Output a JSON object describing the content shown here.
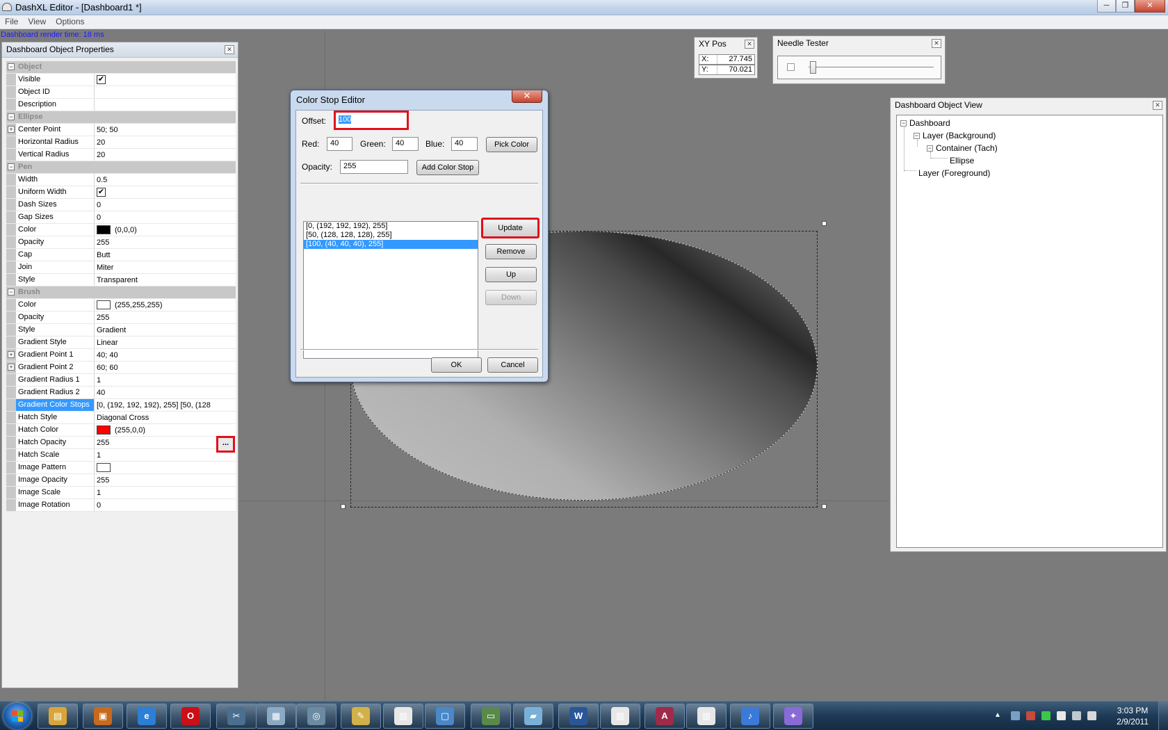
{
  "window": {
    "title": "DashXL Editor - [Dashboard1 *]",
    "controls": {
      "minimize": "─",
      "maximize": "❐",
      "close": "✕"
    }
  },
  "menu": [
    "File",
    "View",
    "Options"
  ],
  "status": {
    "render_time": "Dashboard render time: 18 ms"
  },
  "properties_panel": {
    "title": "Dashboard Object Properties",
    "rows": [
      {
        "type": "category",
        "name": "Object",
        "expander": "−"
      },
      {
        "name": "Visible",
        "value": "",
        "checkbox": true
      },
      {
        "name": "Object ID",
        "value": ""
      },
      {
        "name": "Description",
        "value": ""
      },
      {
        "type": "category",
        "name": "Ellipse",
        "expander": "−"
      },
      {
        "name": "Center Point",
        "value": "50; 50",
        "expander": "+"
      },
      {
        "name": "Horizontal Radius",
        "value": "20"
      },
      {
        "name": "Vertical Radius",
        "value": "20"
      },
      {
        "type": "category",
        "name": "Pen",
        "expander": "−"
      },
      {
        "name": "Width",
        "value": "0.5"
      },
      {
        "name": "Uniform Width",
        "value": "",
        "checkbox": true
      },
      {
        "name": "Dash Sizes",
        "value": "0"
      },
      {
        "name": "Gap Sizes",
        "value": "0"
      },
      {
        "name": "Color",
        "value": "(0,0,0)",
        "swatch": "#000000"
      },
      {
        "name": "Opacity",
        "value": "255"
      },
      {
        "name": "Cap",
        "value": "Butt"
      },
      {
        "name": "Join",
        "value": "Miter"
      },
      {
        "name": "Style",
        "value": "Transparent"
      },
      {
        "type": "category",
        "name": "Brush",
        "expander": "−"
      },
      {
        "name": "Color",
        "value": "(255,255,255)",
        "swatch": "#ffffff"
      },
      {
        "name": "Opacity",
        "value": "255"
      },
      {
        "name": "Style",
        "value": "Gradient"
      },
      {
        "name": "Gradient Style",
        "value": "Linear"
      },
      {
        "name": "Gradient Point 1",
        "value": "40; 40",
        "expander": "+"
      },
      {
        "name": "Gradient Point 2",
        "value": "60; 60",
        "expander": "+"
      },
      {
        "name": "Gradient Radius 1",
        "value": "1"
      },
      {
        "name": "Gradient Radius 2",
        "value": "40"
      },
      {
        "name": "Gradient Color Stops",
        "value": "[0, (192, 192, 192), 255]  [50, (128",
        "selected": true
      },
      {
        "name": "Hatch Style",
        "value": "Diagonal Cross"
      },
      {
        "name": "Hatch Color",
        "value": "(255,0,0)",
        "swatch": "#ff0000"
      },
      {
        "name": "Hatch Opacity",
        "value": "255"
      },
      {
        "name": "Hatch Scale",
        "value": "1"
      },
      {
        "name": "Image Pattern",
        "value": "",
        "swatch": "#ffffff"
      },
      {
        "name": "Image Opacity",
        "value": "255"
      },
      {
        "name": "Image Scale",
        "value": "1"
      },
      {
        "name": "Image Rotation",
        "value": "0"
      }
    ],
    "ellipsis_label": "..."
  },
  "xy_pos": {
    "title": "XY Pos",
    "x_label": "X:",
    "x_value": "27.745",
    "y_label": "Y:",
    "y_value": "70.021"
  },
  "needle_tester": {
    "title": "Needle Tester",
    "slider_value": 0
  },
  "object_view": {
    "title": "Dashboard Object View",
    "tree": [
      {
        "label": "Dashboard",
        "expander": "−"
      },
      {
        "label": "Layer (Background)",
        "expander": "−"
      },
      {
        "label": "Container (Tach)",
        "expander": "−"
      },
      {
        "label": "Ellipse"
      },
      {
        "label": "Layer (Foreground)"
      }
    ]
  },
  "color_stop_editor": {
    "title": "Color Stop Editor",
    "close": "✕",
    "offset_label": "Offset:",
    "offset_value": "100",
    "red_label": "Red:",
    "red_value": "40",
    "green_label": "Green:",
    "green_value": "40",
    "blue_label": "Blue:",
    "blue_value": "40",
    "pick_color": "Pick Color",
    "opacity_label": "Opacity:",
    "opacity_value": "255",
    "add_color_stop": "Add Color Stop",
    "stops": [
      "[0, (192, 192, 192), 255]",
      "[50, (128, 128, 128), 255]",
      "[100, (40, 40, 40), 255]"
    ],
    "selected_stop": 2,
    "update": "Update",
    "remove": "Remove",
    "up": "Up",
    "down": "Down",
    "ok": "OK",
    "cancel": "Cancel"
  },
  "taskbar": {
    "apps": [
      {
        "name": "explorer-icon",
        "glyph": "▤",
        "color": "#d9a53a"
      },
      {
        "name": "virtualpc-icon",
        "glyph": "▣",
        "color": "#c86a1e"
      },
      {
        "name": "ie-icon",
        "glyph": "e",
        "color": "#2b7fd6"
      },
      {
        "name": "opera-icon",
        "glyph": "O",
        "color": "#cc0f16"
      },
      {
        "name": "snipping-icon",
        "glyph": "✂",
        "color": "#4a6f8f"
      },
      {
        "name": "dashxl-icon",
        "glyph": "▦",
        "color": "#8aa9c4"
      },
      {
        "name": "network-icon",
        "glyph": "◎",
        "color": "#6b8aa3"
      },
      {
        "name": "paint-icon",
        "glyph": "✎",
        "color": "#d2b14a"
      },
      {
        "name": "document-icon",
        "glyph": "▥",
        "color": "#e7e7e7"
      },
      {
        "name": "remote-desktop-icon",
        "glyph": "▢",
        "color": "#4a88c8"
      },
      {
        "name": "monitor-icon",
        "glyph": "▭",
        "color": "#5a8a4a"
      },
      {
        "name": "notepad-icon",
        "glyph": "▰",
        "color": "#7ab0d8"
      },
      {
        "name": "word-icon",
        "glyph": "W",
        "color": "#2a5699"
      },
      {
        "name": "editor-icon",
        "glyph": "▥",
        "color": "#e7e7e7"
      },
      {
        "name": "access-icon",
        "glyph": "A",
        "color": "#a02a4a"
      },
      {
        "name": "dashxl-doc-icon",
        "glyph": "▥",
        "color": "#e7e7e7"
      },
      {
        "name": "itunes-icon",
        "glyph": "♪",
        "color": "#3a7ad8"
      },
      {
        "name": "paintnet-icon",
        "glyph": "✦",
        "color": "#8a6ad8"
      }
    ],
    "clock_time": "3:03 PM",
    "clock_date": "2/9/2011"
  }
}
